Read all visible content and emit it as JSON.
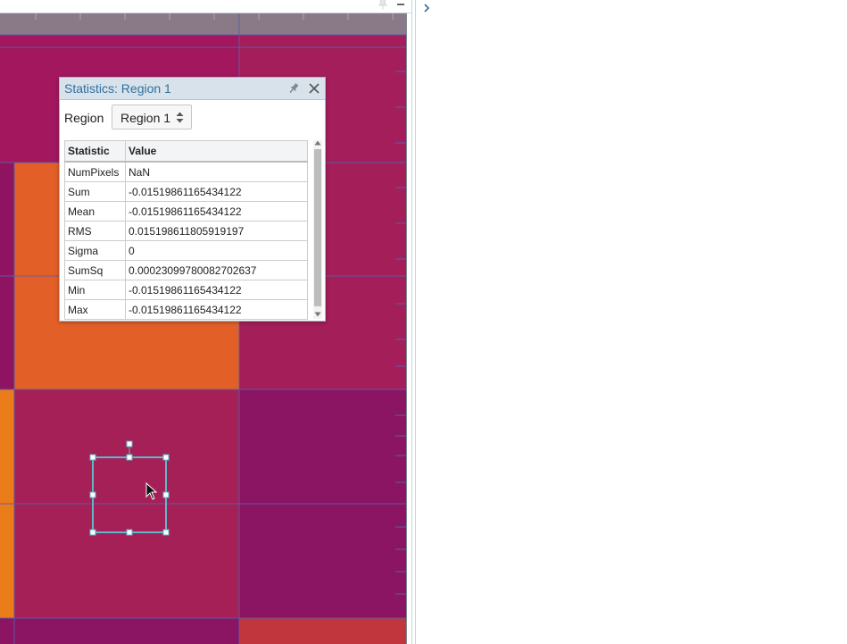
{
  "viewer": {
    "icons": [
      "pin-icon",
      "minimize-icon",
      "chevron-right-icon"
    ],
    "colors": {
      "magenta_dark": "#8c1460",
      "magenta": "#a41e5a",
      "crimson": "#a52158",
      "orange": "#e06224",
      "orange_bright": "#ea7b18",
      "red": "#c0363c",
      "grid_line": "#5a5fa8",
      "region_outline": "#5fb7c9"
    }
  },
  "stats_dialog": {
    "title": "Statistics: Region 1",
    "region_label": "Region",
    "region_selected": "Region 1",
    "table": {
      "headers": [
        "Statistic",
        "Value"
      ],
      "rows": [
        {
          "stat": "NumPixels",
          "value": "NaN"
        },
        {
          "stat": "Sum",
          "value": "-0.015198611654341 22"
        },
        {
          "stat": "Mean",
          "value": "-0.01519861165434122"
        },
        {
          "stat": "RMS",
          "value": "0.015198611805919197"
        },
        {
          "stat": "Sigma",
          "value": "0"
        },
        {
          "stat": "SumSq",
          "value": "0.00023099780082702637"
        },
        {
          "stat": "Min",
          "value": "-0.01519861165434122"
        },
        {
          "stat": "Max",
          "value": "-0.01519861165434122"
        }
      ]
    }
  }
}
